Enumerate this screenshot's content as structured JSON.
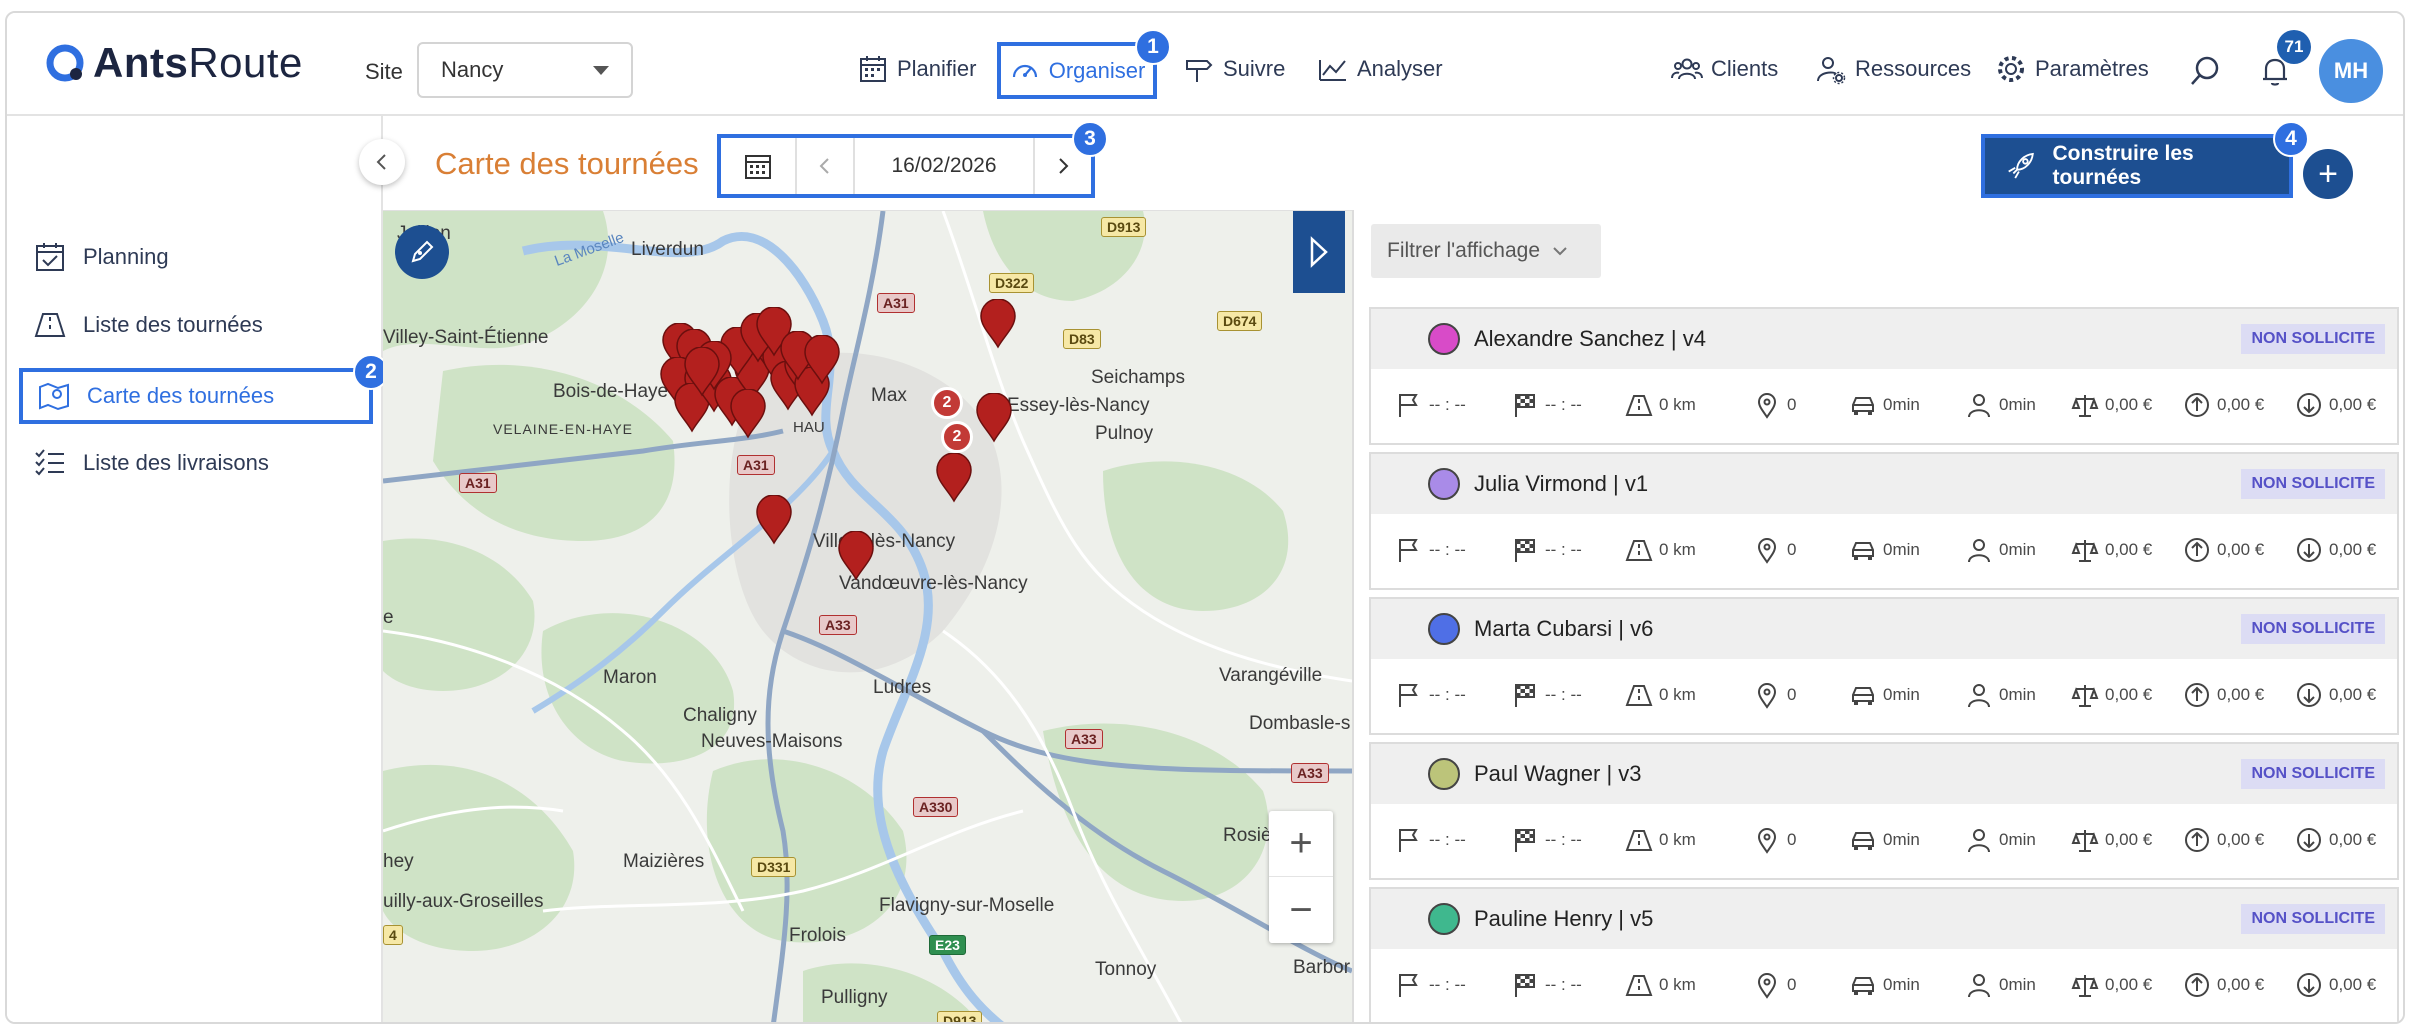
{
  "header": {
    "logo_text_bold": "Ants",
    "logo_text_light": "Route",
    "site_label": "Site",
    "site_value": "Nancy",
    "nav": {
      "planifier": "Planifier",
      "organiser": "Organiser",
      "suivre": "Suivre",
      "analyser": "Analyser",
      "clients": "Clients",
      "ressources": "Ressources",
      "parametres": "Paramètres"
    },
    "notification_count": "71",
    "avatar_initials": "MH"
  },
  "step_badges": {
    "one": "1",
    "two": "2",
    "three": "3",
    "four": "4"
  },
  "sidebar": {
    "items": [
      {
        "label": "Planning"
      },
      {
        "label": "Liste des tournées"
      },
      {
        "label": "Carte des tournées"
      },
      {
        "label": "Liste des livraisons"
      }
    ]
  },
  "toolbar": {
    "page_title": "Carte des tournées",
    "date": "16/02/2026",
    "build_label": "Construire les tournées",
    "plus_label": "+"
  },
  "map": {
    "places": {
      "jaillon": "Jaillon",
      "liverdun": "Liverdun",
      "villey": "Villey-Saint-Étienne",
      "bois_de_haye": "Bois-de-Haye",
      "velaine": "VELAINE-EN-HAYE",
      "seichamps": "Seichamps",
      "essey": "Essey-lès-Nancy",
      "pulnoy": "Pulnoy",
      "villers": "Villers-lès-Nancy",
      "vandoeuvre": "Vandœuvre-lès-Nancy",
      "maron": "Maron",
      "chaligny": "Chaligny",
      "ludres": "Ludres",
      "neuves": "Neuves-Maisons",
      "varangeville": "Varangéville",
      "dombasle": "Dombasle-s",
      "maizieres": "Maizières",
      "chavigny_partial": "uilly-aux-Groseilles",
      "flavigny": "Flavigny-sur-Moselle",
      "frolois": "Frolois",
      "tonnoy": "Tonnoy",
      "pulligny": "Pulligny",
      "barbor": "Barbor",
      "rosie": "Rosiè",
      "hey": "hey",
      "max": "Max",
      "hau": "HAU",
      "e": "e",
      "moselle": "La Moselle"
    },
    "roads": {
      "d913": "D913",
      "d322": "D322",
      "a31_top": "A31",
      "d83": "D83",
      "d674": "D674",
      "a31_left": "A31",
      "a31_mid": "A31",
      "a33_left": "A33",
      "a33_right": "A33",
      "a33_far": "A33",
      "a330": "A330",
      "d331": "D331",
      "e23": "E23",
      "d913_bottom": "D913",
      "d4": "4"
    },
    "cluster_labels": {
      "c1": "2",
      "c2": "2"
    },
    "zoom_in": "+",
    "zoom_out": "−"
  },
  "panel": {
    "filter_label": "Filtrer l'affichage",
    "routes": [
      {
        "name": "Alexandre Sanchez | v4",
        "color": "#d84bc8",
        "status": "NON SOLLICITE",
        "start": "-- : --",
        "end": "-- : --",
        "distance": "0 km",
        "stops": "0",
        "drive": "0min",
        "work": "0min",
        "cost": "0,00 €",
        "up": "0,00 €",
        "down": "0,00 €"
      },
      {
        "name": "Julia Virmond | v1",
        "color": "#a98be8",
        "status": "NON SOLLICITE",
        "start": "-- : --",
        "end": "-- : --",
        "distance": "0 km",
        "stops": "0",
        "drive": "0min",
        "work": "0min",
        "cost": "0,00 €",
        "up": "0,00 €",
        "down": "0,00 €"
      },
      {
        "name": "Marta Cubarsi | v6",
        "color": "#4f6fe6",
        "status": "NON SOLLICITE",
        "start": "-- : --",
        "end": "-- : --",
        "distance": "0 km",
        "stops": "0",
        "drive": "0min",
        "work": "0min",
        "cost": "0,00 €",
        "up": "0,00 €",
        "down": "0,00 €"
      },
      {
        "name": "Paul Wagner | v3",
        "color": "#bcc47a",
        "status": "NON SOLLICITE",
        "start": "-- : --",
        "end": "-- : --",
        "distance": "0 km",
        "stops": "0",
        "drive": "0min",
        "work": "0min",
        "cost": "0,00 €",
        "up": "0,00 €",
        "down": "0,00 €"
      },
      {
        "name": "Pauline Henry | v5",
        "color": "#3fb88e",
        "status": "NON SOLLICITE",
        "start": "-- : --",
        "end": "-- : --",
        "distance": "0 km",
        "stops": "0",
        "drive": "0min",
        "work": "0min",
        "cost": "0,00 €",
        "up": "0,00 €",
        "down": "0,00 €"
      }
    ]
  },
  "colors": {
    "accent": "#2f6fe0",
    "primary_dark": "#1d4f91",
    "title_orange": "#d97f35",
    "pin_red": "#b3201e",
    "status_bg": "#dcdcf4",
    "status_text": "#5551c7"
  }
}
